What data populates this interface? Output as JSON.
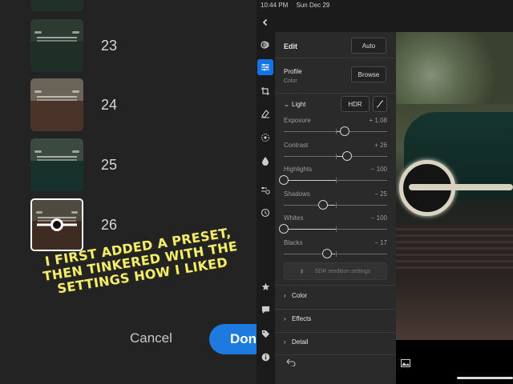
{
  "status_bar": {
    "time": "10:44 PM",
    "date": "Sun Dec 29"
  },
  "presets": [
    {
      "number": "23",
      "selected": false,
      "sky": "#2c3a2f",
      "body": "#1f2f28"
    },
    {
      "number": "24",
      "selected": false,
      "sky": "#6a6458",
      "body": "#4a3328"
    },
    {
      "number": "25",
      "selected": false,
      "sky": "#3a4a40",
      "body": "#16302b"
    },
    {
      "number": "26",
      "selected": true,
      "sky": "#4e4a40",
      "body": "#3e2b22"
    }
  ],
  "caption": "I first added a preset, then tinkered with the settings how I liked",
  "buttons": {
    "cancel": "Cancel",
    "done": "Done"
  },
  "edit_panel": {
    "title": "Edit",
    "auto_label": "Auto",
    "profile_label": "Profile",
    "profile_value": "Color",
    "browse_label": "Browse",
    "light_label": "Light",
    "hdr_label": "HDR",
    "sliders": [
      {
        "label": "Exposure",
        "value": "+ 1.08",
        "pos": 0.59
      },
      {
        "label": "Contrast",
        "value": "+ 26",
        "pos": 0.61
      },
      {
        "label": "Highlights",
        "value": "− 100",
        "pos": 0.0
      },
      {
        "label": "Shadows",
        "value": "− 25",
        "pos": 0.38
      },
      {
        "label": "Whites",
        "value": "− 100",
        "pos": 0.0
      },
      {
        "label": "Blacks",
        "value": "− 17",
        "pos": 0.42
      }
    ],
    "sdr_label": "SDR rendition settings",
    "sections": [
      "Color",
      "Effects",
      "Detail"
    ]
  },
  "colors": {
    "accent": "#1473e6",
    "done": "#1f7ae0",
    "caption": "#f2ec73"
  },
  "rail_icons": [
    "back-chevron-icon",
    "presets-icon",
    "edit-sliders-icon",
    "crop-icon",
    "heal-icon",
    "mask-icon",
    "optics-icon",
    "versions-icon",
    "history-icon",
    "star-icon",
    "comment-icon",
    "tag-icon",
    "info-icon"
  ]
}
